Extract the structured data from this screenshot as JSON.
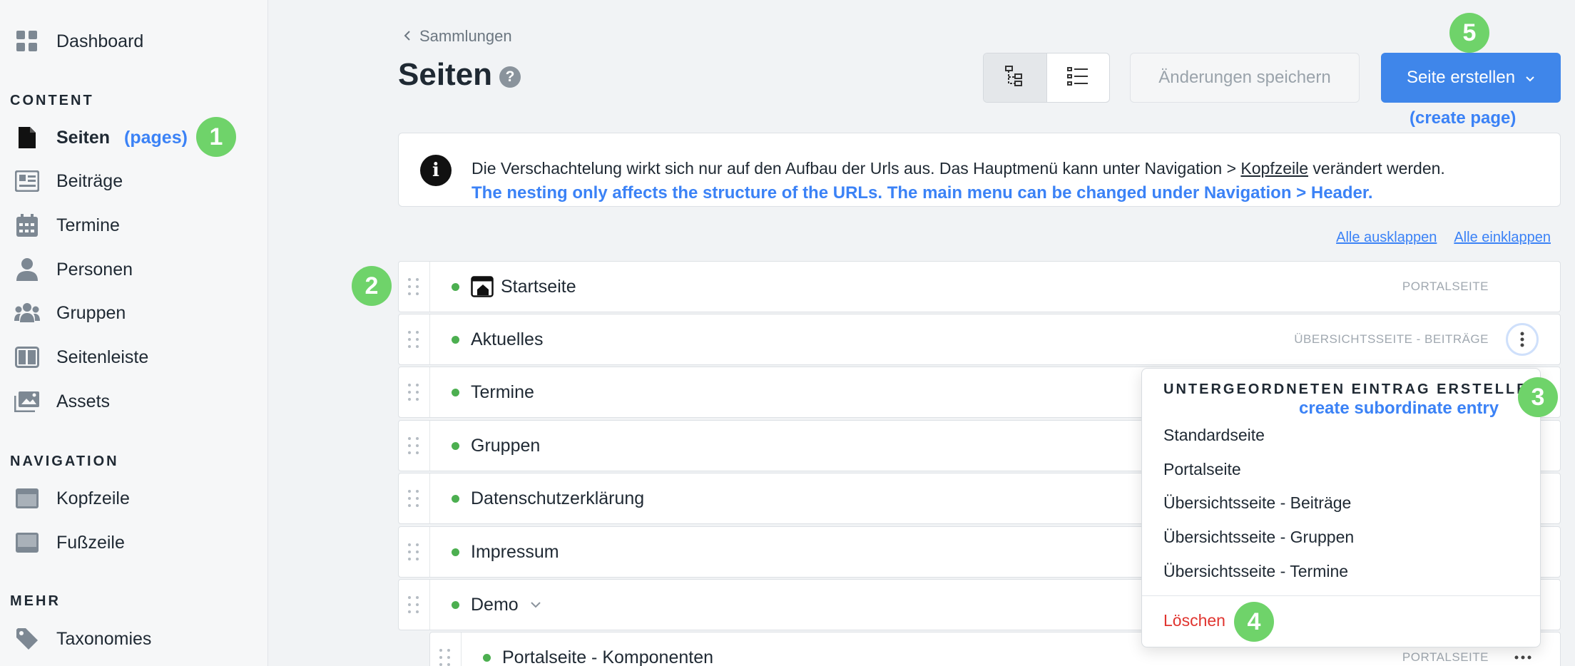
{
  "sidebar": {
    "items": [
      {
        "label": "Dashboard",
        "icon": "dashboard-icon"
      },
      {
        "label": "Seiten",
        "icon": "page-icon",
        "annotation": "(pages)"
      },
      {
        "label": "Beiträge",
        "icon": "newspaper-icon"
      },
      {
        "label": "Termine",
        "icon": "calendar-icon"
      },
      {
        "label": "Personen",
        "icon": "person-icon"
      },
      {
        "label": "Gruppen",
        "icon": "group-icon"
      },
      {
        "label": "Seitenleiste",
        "icon": "sidebar-layout-icon"
      },
      {
        "label": "Assets",
        "icon": "assets-icon"
      },
      {
        "label": "Kopfzeile",
        "icon": "header-layout-icon"
      },
      {
        "label": "Fußzeile",
        "icon": "footer-layout-icon"
      },
      {
        "label": "Taxonomies",
        "icon": "tag-icon"
      }
    ],
    "sections": {
      "content": "CONTENT",
      "navigation": "NAVIGATION",
      "more": "MEHR"
    }
  },
  "header": {
    "breadcrumb": "Sammlungen",
    "title": "Seiten",
    "help": "?",
    "save_label": "Änderungen speichern",
    "create_label": "Seite erstellen",
    "create_annotation": "(create page)"
  },
  "info": {
    "text_before": "Die Verschachtelung wirkt sich nur auf den Aufbau der Urls aus. Das Hauptmenü kann unter Navigation > ",
    "link": "Kopfzeile",
    "text_after": " verändert werden.",
    "annotation": "The nesting only affects the structure of the URLs. The main menu can be changed under Navigation > Header."
  },
  "links": {
    "expand_all": "Alle ausklappen",
    "collapse_all": "Alle einklappen"
  },
  "rows": [
    {
      "title": "Startseite",
      "type": "PORTALSEITE"
    },
    {
      "title": "Aktuelles",
      "type": "ÜBERSICHTSSEITE - BEITRÄGE"
    },
    {
      "title": "Termine",
      "type": ""
    },
    {
      "title": "Gruppen",
      "type": ""
    },
    {
      "title": "Datenschutzerklärung",
      "type": ""
    },
    {
      "title": "Impressum",
      "type": ""
    },
    {
      "title": "Demo",
      "type": ""
    },
    {
      "title": "Portalseite - Komponenten",
      "type": "PORTALSEITE"
    }
  ],
  "dropdown": {
    "heading": "UNTERGEORDNETEN EINTRAG ERSTELLEN",
    "heading_annotation": "create subordinate entry",
    "options": [
      "Standardseite",
      "Portalseite",
      "Übersichtsseite - Beiträge",
      "Übersichtsseite - Gruppen",
      "Übersichtsseite - Termine"
    ],
    "delete": "Löschen"
  },
  "badges": [
    "1",
    "2",
    "3",
    "4",
    "5"
  ],
  "colors": {
    "accent": "#3f86ea",
    "annotation": "#3b82f6",
    "badge": "#6fd36a",
    "status_published": "#4caf50",
    "danger": "#e0342f"
  }
}
